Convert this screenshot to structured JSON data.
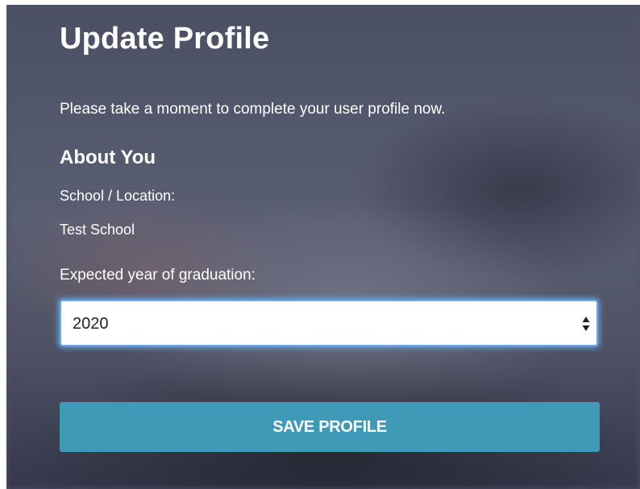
{
  "form": {
    "title": "Update Profile",
    "intro": "Please take a moment to complete your user profile now.",
    "section_heading": "About You",
    "school_label": "School / Location:",
    "school_value": "Test School",
    "graduation_label": "Expected year of graduation:",
    "graduation_select": {
      "selected": "2020",
      "icon": "up-down-arrows-icon"
    },
    "save_label": "SAVE PROFILE"
  },
  "colors": {
    "background_overlay": "#50546a",
    "text": "#ffffff",
    "button": "#3f9ab7",
    "focus_ring": "#6fa8ef"
  }
}
